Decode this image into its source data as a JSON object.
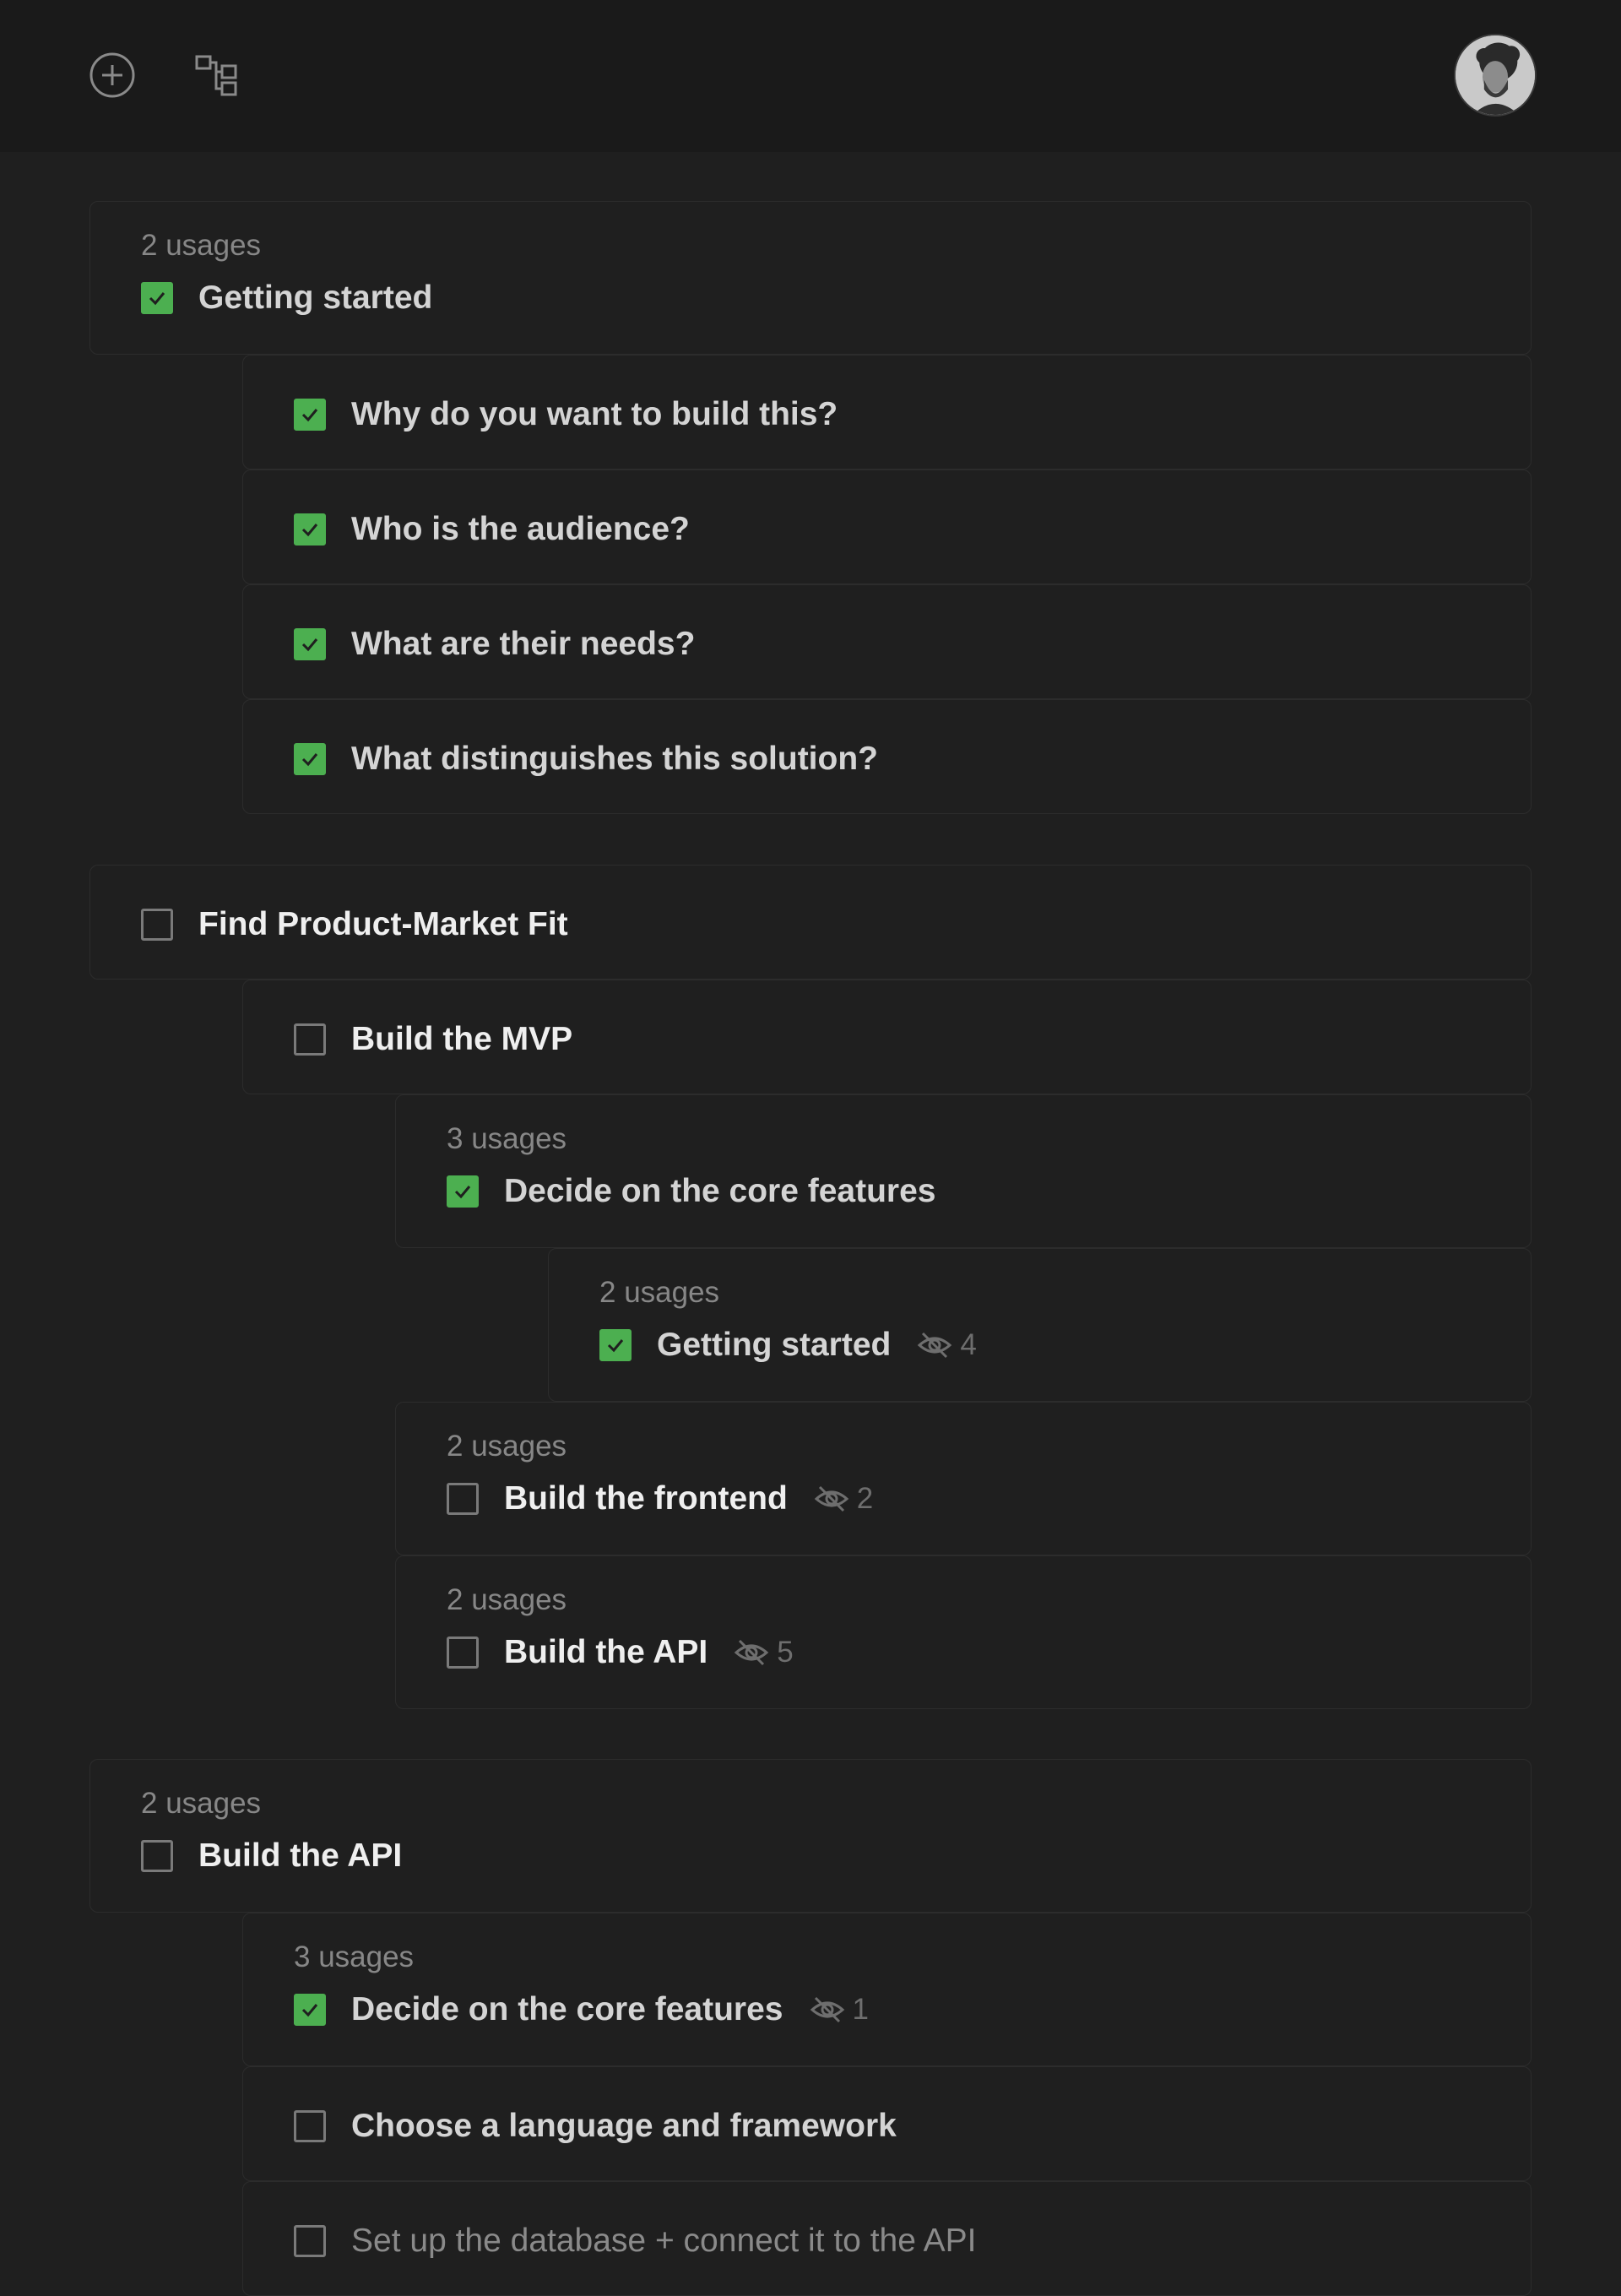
{
  "header": {
    "add_icon": "plus-circle-icon",
    "tree_icon": "hierarchy-icon",
    "avatar_alt": "user-avatar"
  },
  "items": [
    {
      "id": "getting-started-1",
      "usage": "2 usages",
      "label": "Getting started",
      "checked": true
    },
    {
      "id": "why-build",
      "label": "Why do you want to build this?",
      "checked": true
    },
    {
      "id": "audience",
      "label": "Who is the audience?",
      "checked": true
    },
    {
      "id": "needs",
      "label": "What are their needs?",
      "checked": true
    },
    {
      "id": "distinguishes",
      "label": "What distinguishes this solution?",
      "checked": true
    },
    {
      "id": "pmf",
      "label": "Find Product-Market Fit",
      "checked": false
    },
    {
      "id": "mvp",
      "label": "Build the MVP",
      "checked": false
    },
    {
      "id": "core-features-1",
      "usage": "3 usages",
      "label": "Decide on the core features",
      "checked": true
    },
    {
      "id": "getting-started-2",
      "usage": "2 usages",
      "label": "Getting started",
      "checked": true,
      "hidden": "4"
    },
    {
      "id": "frontend",
      "usage": "2 usages",
      "label": "Build the frontend",
      "checked": false,
      "hidden": "2"
    },
    {
      "id": "api-1",
      "usage": "2 usages",
      "label": "Build the API",
      "checked": false,
      "hidden": "5"
    },
    {
      "id": "api-2",
      "usage": "2 usages",
      "label": "Build the API",
      "checked": false
    },
    {
      "id": "core-features-2",
      "usage": "3 usages",
      "label": "Decide on the core features",
      "checked": true,
      "hidden": "1"
    },
    {
      "id": "language",
      "label": "Choose a language and framework",
      "checked": false
    },
    {
      "id": "database",
      "label": "Set up the database + connect it to the API",
      "checked": false
    }
  ],
  "colors": {
    "background": "#1f1f1f",
    "topbar": "#1a1a1a",
    "checked": "#4caf50",
    "usage_text": "#878787"
  }
}
